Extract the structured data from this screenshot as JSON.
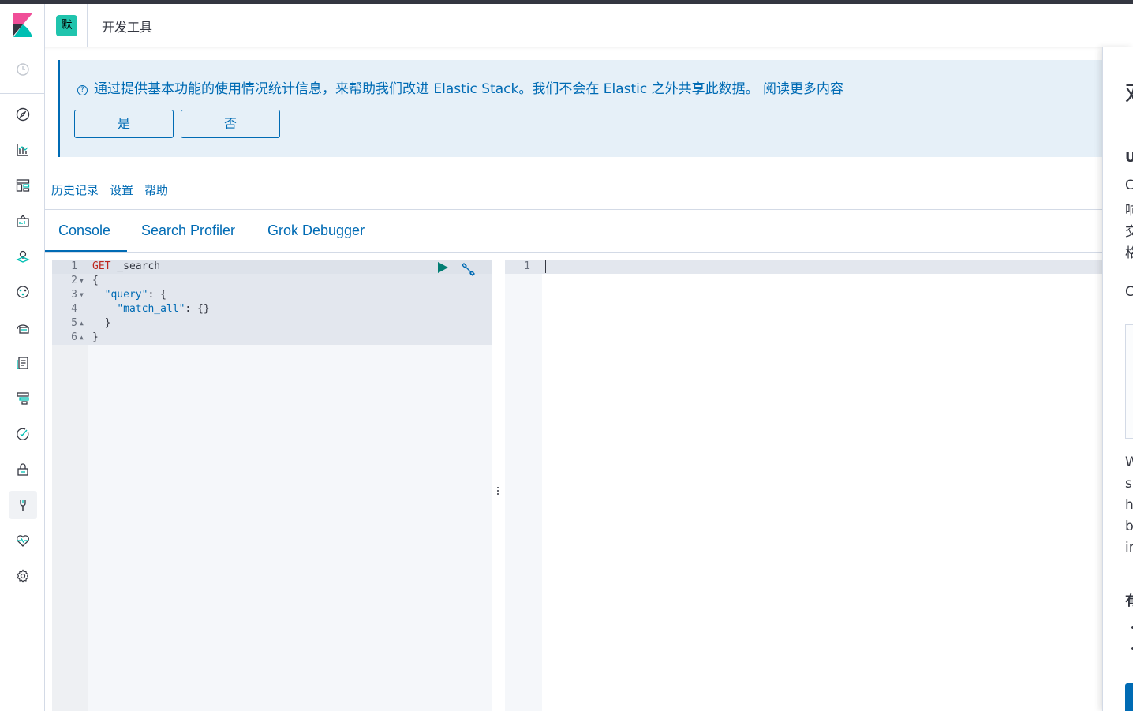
{
  "header": {
    "space_initial": "默",
    "app_title": "开发工具"
  },
  "sidenav": {
    "items": [
      {
        "icon": "clock-icon",
        "label": "Recently viewed"
      },
      {
        "icon": "compass-icon",
        "label": "Discover"
      },
      {
        "icon": "visualize-icon",
        "label": "Visualize"
      },
      {
        "icon": "dashboard-icon",
        "label": "Dashboard"
      },
      {
        "icon": "canvas-icon",
        "label": "Canvas"
      },
      {
        "icon": "maps-icon",
        "label": "Maps"
      },
      {
        "icon": "ml-icon",
        "label": "Machine Learning"
      },
      {
        "icon": "infrastructure-icon",
        "label": "Infrastructure"
      },
      {
        "icon": "logs-icon",
        "label": "Logs"
      },
      {
        "icon": "apm-icon",
        "label": "APM"
      },
      {
        "icon": "uptime-icon",
        "label": "Uptime"
      },
      {
        "icon": "siem-icon",
        "label": "SIEM"
      },
      {
        "icon": "devtools-icon",
        "label": "Dev Tools"
      },
      {
        "icon": "monitoring-icon",
        "label": "Stack Monitoring"
      },
      {
        "icon": "gear-icon",
        "label": "Management"
      }
    ]
  },
  "callout": {
    "text": "通过提供基本功能的使用情况统计信息，来帮助我们改进 Elastic Stack。我们不会在 Elastic 之外共享此数据。 阅读更多内容",
    "yes_label": "是",
    "no_label": "否"
  },
  "menu": {
    "history": "历史记录",
    "settings": "设置",
    "help": "帮助"
  },
  "tabs": [
    {
      "label": "Console",
      "active": true
    },
    {
      "label": "Search Profiler",
      "active": false
    },
    {
      "label": "Grok Debugger",
      "active": false
    }
  ],
  "editor": {
    "lines": [
      {
        "num": "1",
        "fold": "",
        "method": "GET",
        "rest": " _search"
      },
      {
        "num": "2",
        "fold": "▼",
        "method": "",
        "rest": "{"
      },
      {
        "num": "3",
        "fold": "▼",
        "method": "",
        "rest": "  \"query\": {"
      },
      {
        "num": "4",
        "fold": "",
        "method": "",
        "rest": "    \"match_all\": {}"
      },
      {
        "num": "5",
        "fold": "▲",
        "method": "",
        "rest": "  }"
      },
      {
        "num": "6",
        "fold": "▲",
        "method": "",
        "rest": "}"
      }
    ]
  },
  "output": {
    "line_num": "1"
  },
  "flyout": {
    "title_char": "欢",
    "heading_char": "U",
    "lines_a": [
      "C",
      "响",
      "交",
      "格"
    ],
    "line_b": "C",
    "lines_c": [
      "W",
      "s",
      "h",
      "b",
      "ir"
    ],
    "heading2_char": "有"
  },
  "colors": {
    "accent": "#006bb4",
    "space_avatar": "#20c4ad",
    "method": "#bd271e"
  }
}
